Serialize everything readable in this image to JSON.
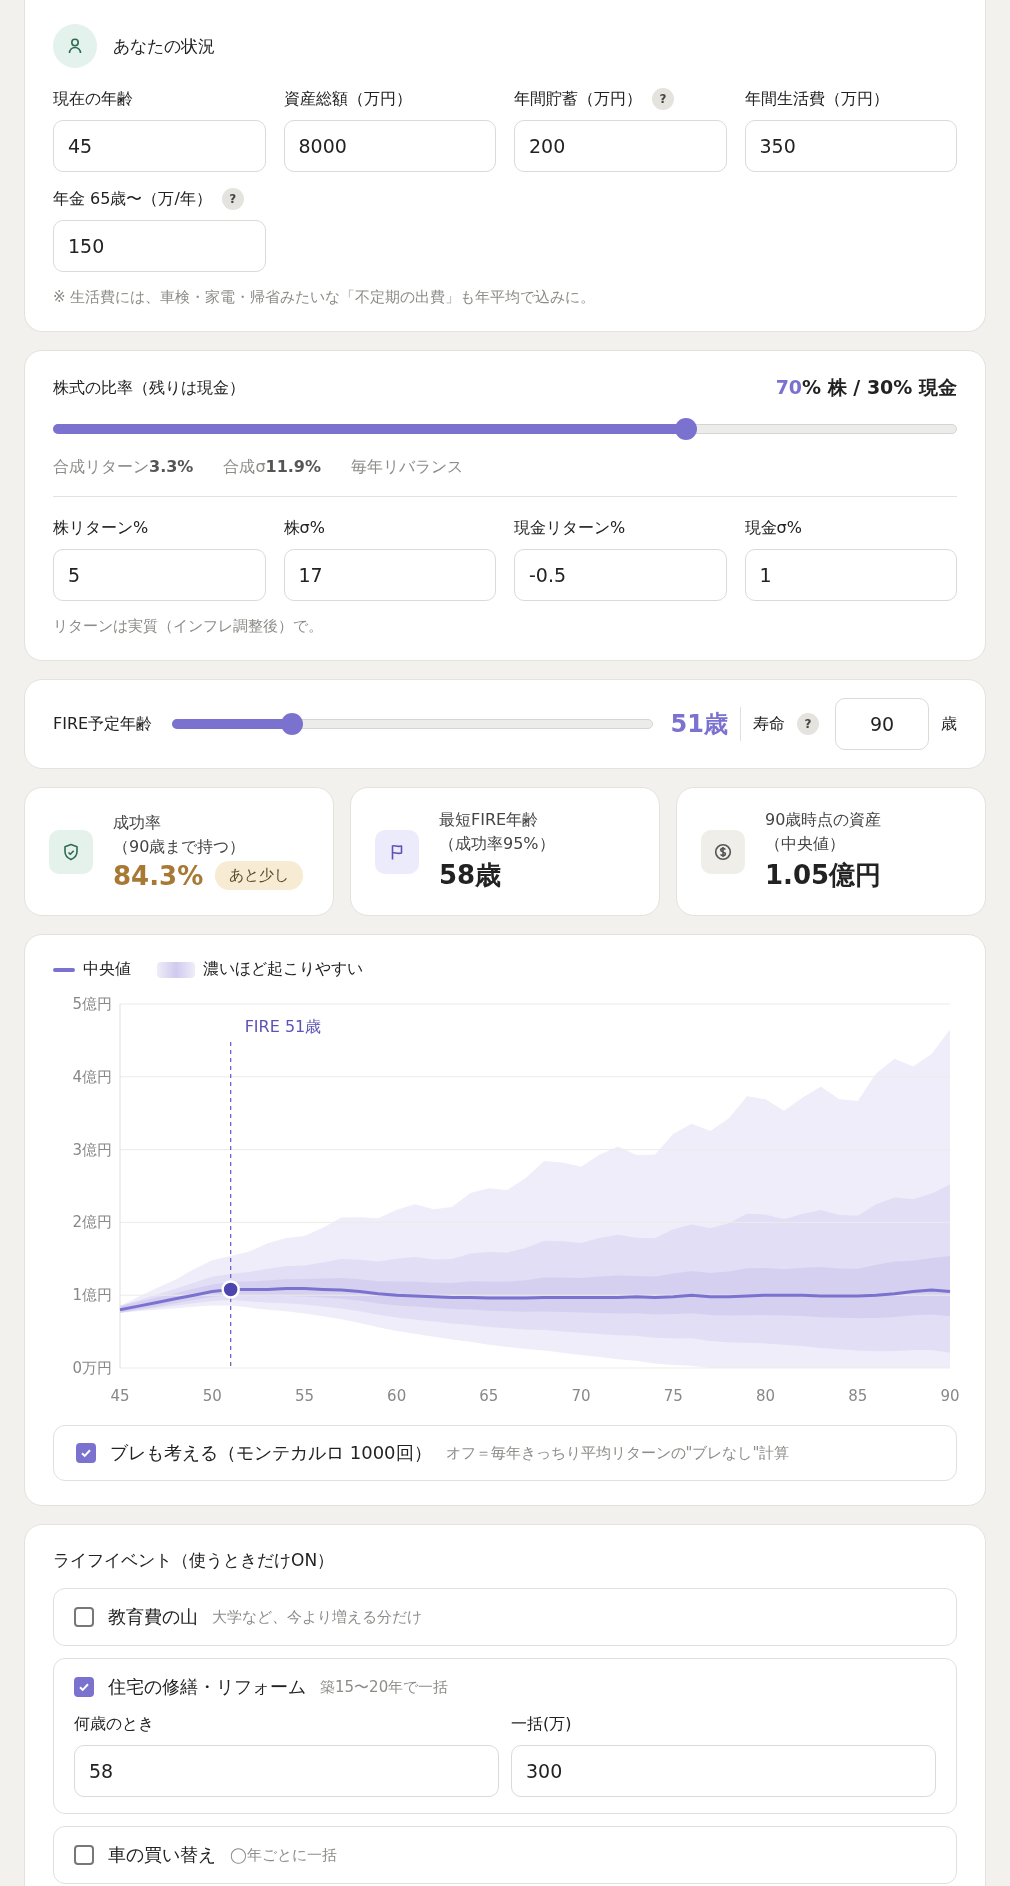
{
  "profile": {
    "title": "あなたの状況",
    "fields": [
      {
        "label": "現在の年齢",
        "value": "45"
      },
      {
        "label": "資産総額（万円）",
        "value": "8000"
      },
      {
        "label": "年間貯蓄（万円）",
        "value": "200",
        "help": "?"
      },
      {
        "label": "年間生活費（万円）",
        "value": "350"
      },
      {
        "label": "年金 65歳〜（万/年）",
        "value": "150",
        "help": "?"
      }
    ],
    "note": "※ 生活費には、車検・家電・帰省みたいな「不定期の出費」も年平均で込みに。"
  },
  "allocation": {
    "title": "株式の比率（残りは現金）",
    "ratio_highlight": "70",
    "ratio_rest": "% 株 / 30% 現金",
    "level": 0.7,
    "stats": [
      {
        "label": "合成リターン",
        "value": "3.3%"
      },
      {
        "label": "合成σ",
        "value": "11.9%"
      },
      {
        "label": "毎年リバランス"
      }
    ],
    "fields": [
      {
        "label": "株リターン%",
        "value": "5"
      },
      {
        "label": "株σ%",
        "value": "17"
      },
      {
        "label": "現金リターン%",
        "value": "-0.5"
      },
      {
        "label": "現金σ%",
        "value": "1"
      }
    ],
    "note": "リターンは実質（インフレ調整後）で。"
  },
  "fire": {
    "label": "FIRE予定年齢",
    "level": 0.25,
    "value": "51歳",
    "lifespan_label": "寿命",
    "lifespan_help": "?",
    "lifespan": "90",
    "lifespan_unit": "歳"
  },
  "stats": [
    {
      "kind": "success",
      "title": "成功率",
      "subtitle": "（90歳まで持つ）",
      "value": "84.3%",
      "badge": "あと少し"
    },
    {
      "kind": "fire",
      "title": "最短FIRE年齢",
      "subtitle": "（成功率95%）",
      "value": "58歳"
    },
    {
      "kind": "assets",
      "title": "90歳時点の資産",
      "subtitle": "（中央値）",
      "value": "1.05億円"
    }
  ],
  "chart": {
    "legend_band": "濃いほど起こりやすい",
    "chart_data": {
      "type": "line",
      "grid": true,
      "x": [
        45,
        46,
        47,
        48,
        49,
        50,
        51,
        52,
        53,
        54,
        55,
        56,
        57,
        58,
        59,
        60,
        61,
        62,
        63,
        64,
        65,
        66,
        67,
        68,
        69,
        70,
        71,
        72,
        73,
        74,
        75,
        76,
        77,
        78,
        79,
        80,
        81,
        82,
        83,
        84,
        85,
        86,
        87,
        88,
        89,
        90
      ],
      "series": [
        {
          "name": "中央値",
          "color": "#7b72d0",
          "values": [
            0.8,
            0.85,
            0.9,
            0.95,
            1.0,
            1.05,
            1.08,
            1.08,
            1.08,
            1.09,
            1.09,
            1.08,
            1.07,
            1.05,
            1.02,
            1.0,
            0.99,
            0.98,
            0.97,
            0.97,
            0.96,
            0.96,
            0.96,
            0.97,
            0.97,
            0.97,
            0.97,
            0.97,
            0.98,
            0.97,
            0.98,
            1.0,
            0.98,
            0.98,
            0.99,
            1.0,
            1.0,
            1.0,
            0.99,
            0.99,
            0.99,
            1.0,
            1.02,
            1.05,
            1.07,
            1.05
          ]
        }
      ],
      "xlim": [
        45,
        90
      ],
      "ylim": [
        0,
        5
      ],
      "xticks": [
        45,
        50,
        55,
        60,
        65,
        70,
        75,
        80,
        85,
        90
      ],
      "yticks": [
        {
          "value": 0,
          "label": "0万円"
        },
        {
          "value": 1,
          "label": "1億円"
        },
        {
          "value": 2,
          "label": "2億円"
        },
        {
          "value": 3,
          "label": "3億円"
        },
        {
          "value": 4,
          "label": "4億円"
        },
        {
          "value": 5,
          "label": "5億円"
        }
      ],
      "ref_lines": [
        {
          "axis": "x",
          "value": 51,
          "label": "FIRE 51歳"
        }
      ]
    },
    "montecarlo": {
      "checked": true,
      "label": "ブレも考える（モンテカルロ 1000回）",
      "hint": "オフ＝毎年きっちり平均リターンの\"ブレなし\"計算"
    }
  },
  "life": {
    "title": "ライフイベント（使うときだけON）",
    "events": [
      {
        "checked": false,
        "title": "教育費の山",
        "hint": "大学など、今より増える分だけ"
      },
      {
        "checked": true,
        "title": "住宅の修繕・リフォーム",
        "hint": "築15〜20年で一括",
        "fields": [
          {
            "label": "何歳のとき",
            "value": "58"
          },
          {
            "label": "一括(万)",
            "value": "300"
          }
        ]
      },
      {
        "checked": false,
        "title": "車の買い替え",
        "hint": "◯年ごとに一括"
      }
    ]
  }
}
